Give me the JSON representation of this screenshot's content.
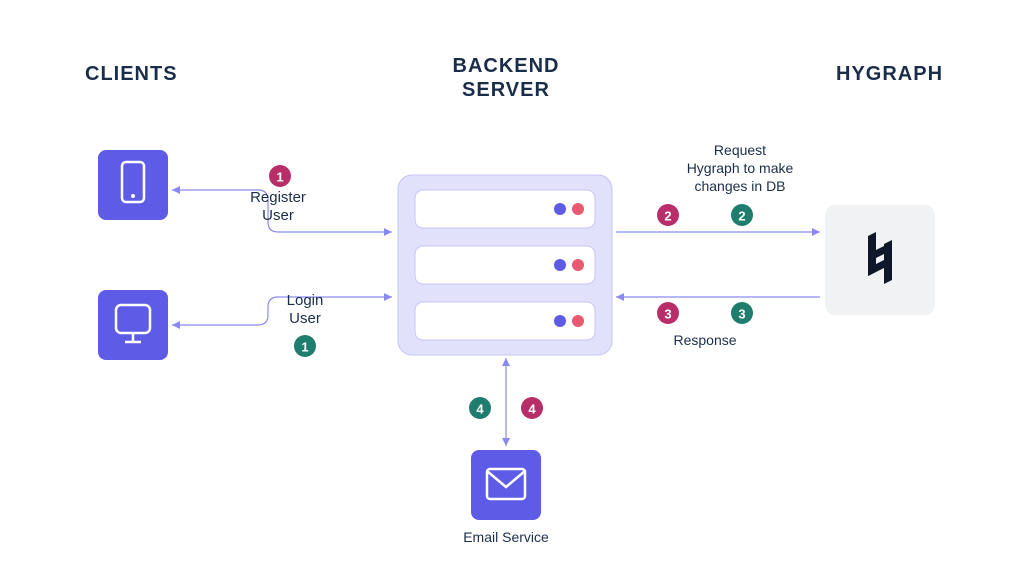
{
  "headings": {
    "clients": "CLIENTS",
    "backend1": "BACKEND",
    "backend2": "SERVER",
    "hygraph": "HYGRAPH"
  },
  "labels": {
    "register1": "Register",
    "register2": "User",
    "login1": "Login",
    "login2": "User",
    "request1": "Request",
    "request2": "Hygraph to make",
    "request3": "changes in DB",
    "response": "Response",
    "email": "Email Service"
  },
  "badges": {
    "b1": "1",
    "b2": "2",
    "b3": "3",
    "b4": "4"
  },
  "colors": {
    "primary": "#5E5CE6",
    "pink": "#B82E68",
    "teal": "#1E7D6C"
  }
}
